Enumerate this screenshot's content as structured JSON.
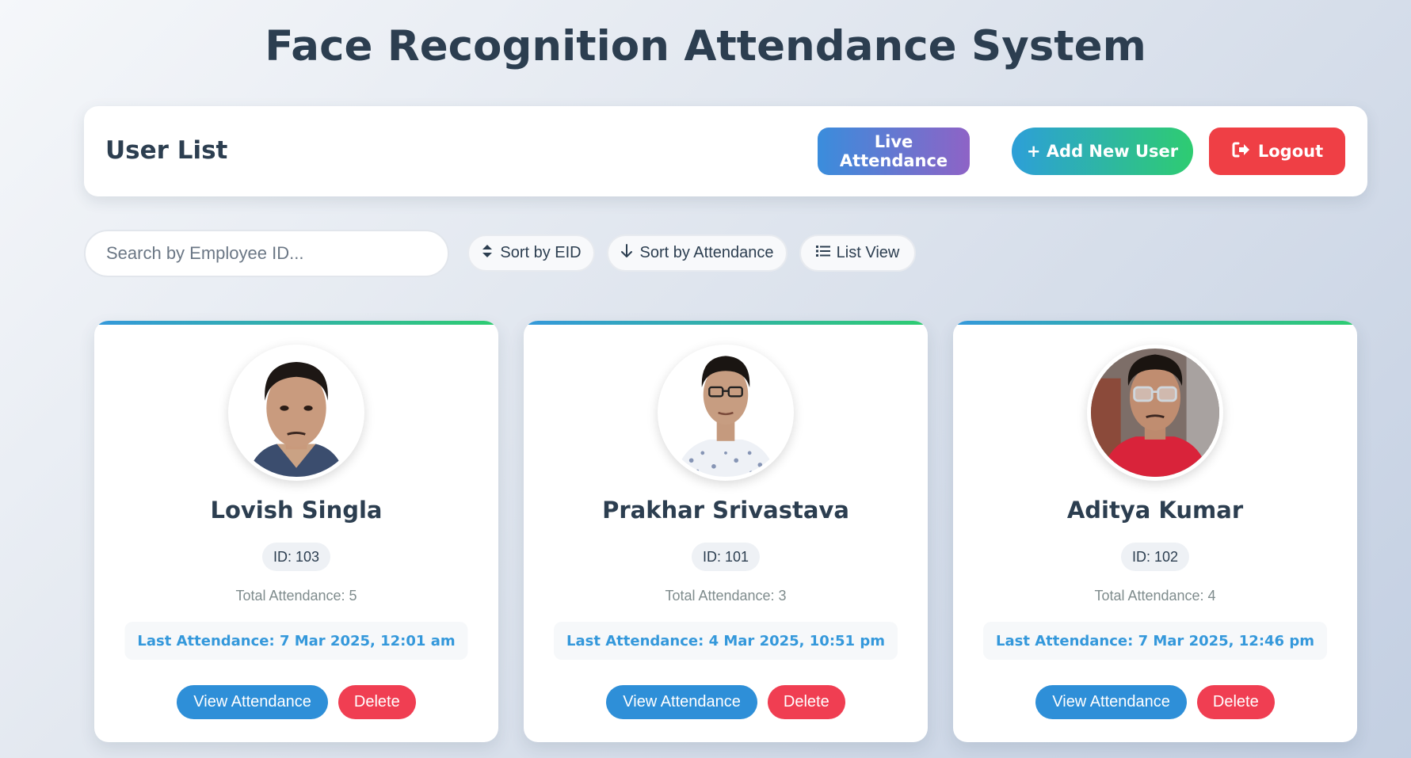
{
  "page_title": "Face Recognition Attendance System",
  "header": {
    "title": "User List",
    "live_attendance_label": "Live Attendance",
    "add_user_label": "+ Add New User",
    "logout_label": "Logout",
    "logout_icon": "sign-out-icon"
  },
  "toolbar": {
    "search_placeholder": "Search by Employee ID...",
    "sort_eid_label": "Sort by EID",
    "sort_eid_icon": "sort-icon",
    "sort_attendance_label": "Sort by Attendance",
    "sort_attendance_icon": "arrow-down-icon",
    "list_view_label": "List View",
    "list_view_icon": "list-icon"
  },
  "colors": {
    "accent_blue": "#3498db",
    "accent_green": "#2ecc71",
    "danger_red": "#f03e52",
    "text_dark": "#2c3e50"
  },
  "users": [
    {
      "name": "Lovish Singla",
      "id": "ID: 103",
      "total_attendance": "Total Attendance: 5",
      "last_attendance": "Last Attendance: 7 Mar 2025, 12:01 am",
      "view_label": "View Attendance",
      "delete_label": "Delete"
    },
    {
      "name": "Prakhar Srivastava",
      "id": "ID: 101",
      "total_attendance": "Total Attendance: 3",
      "last_attendance": "Last Attendance: 4 Mar 2025, 10:51 pm",
      "view_label": "View Attendance",
      "delete_label": "Delete"
    },
    {
      "name": "Aditya Kumar",
      "id": "ID: 102",
      "total_attendance": "Total Attendance: 4",
      "last_attendance": "Last Attendance: 7 Mar 2025, 12:46 pm",
      "view_label": "View Attendance",
      "delete_label": "Delete"
    }
  ]
}
